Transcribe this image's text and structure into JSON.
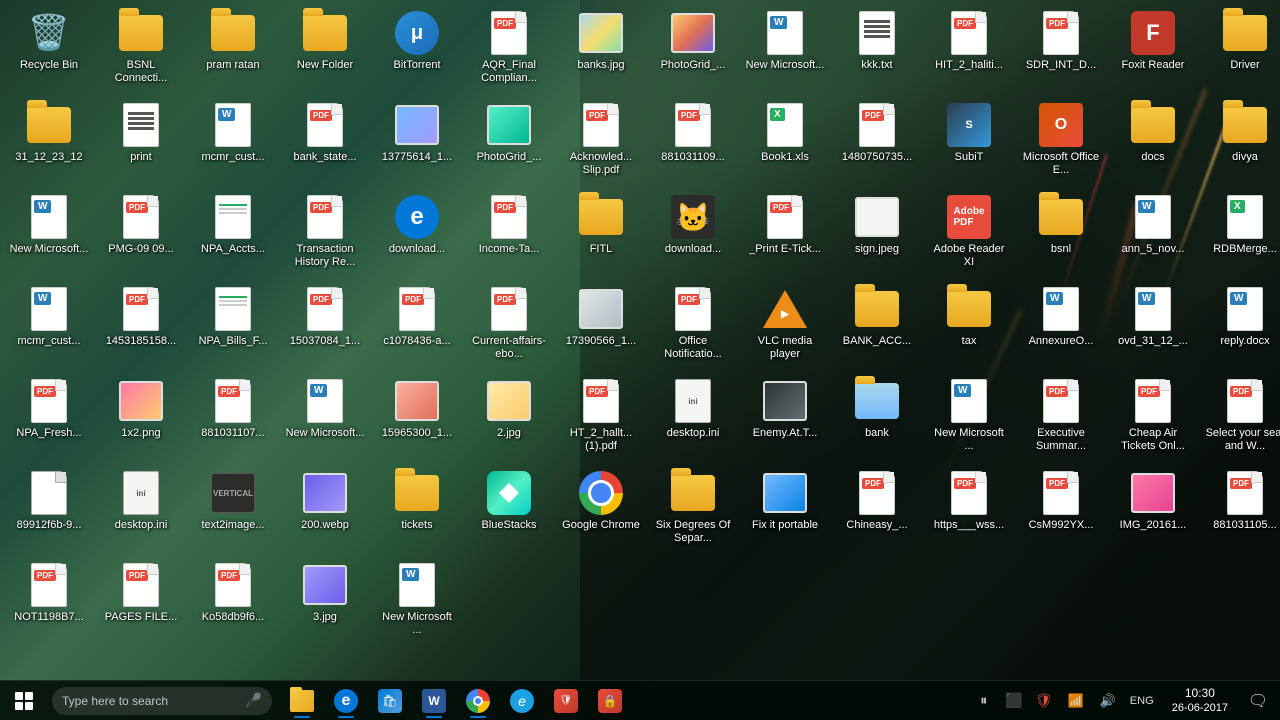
{
  "desktop": {
    "title": "Windows 10 Desktop",
    "background": "forest-highway-night"
  },
  "icons": {
    "row1": [
      {
        "id": "recycle-bin",
        "label": "Recycle Bin",
        "type": "recycle",
        "emoji": "🗑️"
      },
      {
        "id": "bsnl",
        "label": "BSNL Connecti...",
        "type": "folder"
      },
      {
        "id": "pram-ratan",
        "label": "pram ratan",
        "type": "folder"
      },
      {
        "id": "new-folder",
        "label": "New Folder",
        "type": "folder"
      },
      {
        "id": "bittorrent",
        "label": "BitTorrent",
        "type": "bittorrent"
      },
      {
        "id": "aqr-final",
        "label": "AQR_Final Complian...",
        "type": "pdf"
      },
      {
        "id": "banksjpg",
        "label": "banks.jpg",
        "type": "jpg"
      },
      {
        "id": "photogrid",
        "label": "PhotoGrid_...",
        "type": "jpg"
      },
      {
        "id": "new-ms1",
        "label": "New Microsoft...",
        "type": "word"
      },
      {
        "id": "kkktxt",
        "label": "kkk.txt",
        "type": "txt"
      },
      {
        "id": "hit2-halti",
        "label": "HIT_2_haliti...",
        "type": "pdf"
      },
      {
        "id": "sdr-int",
        "label": "SDR_INT_D...",
        "type": "pdf"
      }
    ],
    "row2": [
      {
        "id": "foxit",
        "label": "Foxit Reader",
        "type": "foxit"
      },
      {
        "id": "driver",
        "label": "Driver",
        "type": "folder"
      },
      {
        "id": "date-folder",
        "label": "31_12_23_12",
        "type": "folder"
      },
      {
        "id": "print",
        "label": "print",
        "type": "txt"
      },
      {
        "id": "mcmr-cust1",
        "label": "mcmr_cust...",
        "type": "word"
      },
      {
        "id": "bank-state",
        "label": "bank_state...",
        "type": "pdf"
      },
      {
        "id": "13775614",
        "label": "13775614_1...",
        "type": "jpg"
      },
      {
        "id": "photogrid2",
        "label": "PhotoGrid_...",
        "type": "jpg"
      },
      {
        "id": "acknowledge",
        "label": "Acknowled... Slip.pdf",
        "type": "pdf"
      },
      {
        "id": "8810311-09",
        "label": "881031109...",
        "type": "pdf"
      },
      {
        "id": "book1",
        "label": "Book1.xls",
        "type": "excel"
      },
      {
        "id": "1480750735",
        "label": "1480750735...",
        "type": "pdf"
      }
    ],
    "row3": [
      {
        "id": "subit",
        "label": "SubiT",
        "type": "subit"
      },
      {
        "id": "msoffice-e",
        "label": "Microsoft Office E...",
        "type": "msoffice"
      },
      {
        "id": "docs",
        "label": "docs",
        "type": "folder"
      },
      {
        "id": "divya",
        "label": "divya",
        "type": "folder"
      },
      {
        "id": "new-ms2",
        "label": "New Microsoft...",
        "type": "word"
      },
      {
        "id": "pmg-09",
        "label": "PMG-09 09...",
        "type": "pdf"
      },
      {
        "id": "npa-accts",
        "label": "NPA_Accts...",
        "type": "spreadsheet"
      },
      {
        "id": "transaction",
        "label": "Transaction History Re...",
        "type": "pdf"
      },
      {
        "id": "download1",
        "label": "download...",
        "type": "ie"
      },
      {
        "id": "income-tax",
        "label": "Income-Ta...",
        "type": "pdf"
      },
      {
        "id": "fitl",
        "label": "FITL",
        "type": "folder"
      },
      {
        "id": "download2",
        "label": "download...",
        "type": "jpg"
      },
      {
        "id": "print-e-tick",
        "label": "_Print E-Tick...",
        "type": "pdf"
      },
      {
        "id": "sign-jpeg",
        "label": "sign.jpeg",
        "type": "jpg"
      }
    ],
    "row4": [
      {
        "id": "adobe",
        "label": "Adobe Reader XI",
        "type": "adobe"
      },
      {
        "id": "bsnl2",
        "label": "bsnl",
        "type": "folder"
      },
      {
        "id": "ann5nov",
        "label": "ann_5_nov...",
        "type": "word"
      },
      {
        "id": "rdbmerge",
        "label": "RDBMerge...",
        "type": "excel"
      },
      {
        "id": "mcmr-cust2",
        "label": "mcmr_cust...",
        "type": "word"
      },
      {
        "id": "1453185158",
        "label": "1453185158...",
        "type": "pdf"
      },
      {
        "id": "npa-bills",
        "label": "NPA_Bills_F...",
        "type": "spreadsheet"
      },
      {
        "id": "15037084",
        "label": "15037084_1...",
        "type": "pdf"
      },
      {
        "id": "c1078436",
        "label": "c1078436-a...",
        "type": "pdf"
      },
      {
        "id": "current-affairs",
        "label": "Current-affairs-ebo...",
        "type": "pdf"
      },
      {
        "id": "17390566",
        "label": "17390566_1...",
        "type": "jpg"
      },
      {
        "id": "office-notif",
        "label": "Office Notificatio...",
        "type": "pdf"
      }
    ],
    "row5": [
      {
        "id": "vlc",
        "label": "VLC media player",
        "type": "vlc"
      },
      {
        "id": "bank-acc",
        "label": "BANK_ACC...",
        "type": "folder"
      },
      {
        "id": "tax",
        "label": "tax",
        "type": "folder"
      },
      {
        "id": "annexure",
        "label": "AnnexureO...",
        "type": "word"
      },
      {
        "id": "ovd31",
        "label": "ovd_31_12_...",
        "type": "word"
      },
      {
        "id": "reply-docx",
        "label": "reply.docx",
        "type": "word"
      },
      {
        "id": "npa-fresh",
        "label": "NPA_Fresh...",
        "type": "pdf"
      },
      {
        "id": "1x2png",
        "label": "1x2.png",
        "type": "png"
      },
      {
        "id": "881031107",
        "label": "881031107...",
        "type": "pdf"
      },
      {
        "id": "new-ms3",
        "label": "New Microsoft...",
        "type": "word"
      },
      {
        "id": "15965300",
        "label": "15965300_1...",
        "type": "pdf"
      },
      {
        "id": "2jpg",
        "label": "2.jpg",
        "type": "jpg"
      },
      {
        "id": "ht2-hallt",
        "label": "HT_2_hallt... (1).pdf",
        "type": "pdf"
      }
    ],
    "row6": [
      {
        "id": "desktop-ini1",
        "label": "desktop.ini",
        "type": "ini"
      },
      {
        "id": "enemy-at",
        "label": "Enemy.At.T...",
        "type": "jpg"
      },
      {
        "id": "bank",
        "label": "bank",
        "type": "folder"
      },
      {
        "id": "new-ms4",
        "label": "New Microsoft ...",
        "type": "word"
      },
      {
        "id": "executive",
        "label": "Executive Summar...",
        "type": "pdf"
      },
      {
        "id": "cheap-air",
        "label": "Cheap Air Tickets Onl...",
        "type": "pdf"
      },
      {
        "id": "select-seat",
        "label": "Select your seat and W...",
        "type": "pdf"
      },
      {
        "id": "89912f6b",
        "label": "89912f6b-9...",
        "type": "generic"
      },
      {
        "id": "desktop-ini2",
        "label": "desktop.ini",
        "type": "ini"
      },
      {
        "id": "text2image",
        "label": "text2image...",
        "type": "txt"
      },
      {
        "id": "200webp",
        "label": "200.webp",
        "type": "webp"
      },
      {
        "id": "tickets",
        "label": "tickets",
        "type": "folder"
      },
      {
        "id": "bluestacks",
        "label": "BlueStacks",
        "type": "bluestacks"
      }
    ],
    "row7": [
      {
        "id": "google-chrome",
        "label": "Google Chrome",
        "type": "chrome"
      },
      {
        "id": "six-degrees",
        "label": "Six Degrees Of Separ...",
        "type": "folder"
      },
      {
        "id": "fix-portable",
        "label": "Fix it portable",
        "type": "jpg"
      },
      {
        "id": "chineasy",
        "label": "Chineasy_...",
        "type": "pdf"
      },
      {
        "id": "https-wss",
        "label": "https___wss...",
        "type": "pdf"
      },
      {
        "id": "csm992yx",
        "label": "CsM992YX...",
        "type": "pdf"
      },
      {
        "id": "img-20161",
        "label": "IMG_20161...",
        "type": "jpg"
      },
      {
        "id": "881031105",
        "label": "881031105...",
        "type": "pdf"
      },
      {
        "id": "not1198b7",
        "label": "NOT1198B7...",
        "type": "pdf"
      },
      {
        "id": "pages-file",
        "label": "PAGES FILE...",
        "type": "pdf"
      },
      {
        "id": "ko58db9f6",
        "label": "Ko58db9f6...",
        "type": "pdf"
      },
      {
        "id": "3jpg",
        "label": "3.jpg",
        "type": "jpg"
      },
      {
        "id": "new-ms5",
        "label": "New Microsoft ...",
        "type": "word"
      }
    ]
  },
  "taskbar": {
    "search_placeholder": "Type here to search",
    "icons": [
      {
        "id": "file-explorer",
        "label": "File Explorer",
        "type": "folder-taskbar"
      },
      {
        "id": "edge",
        "label": "Microsoft Edge",
        "type": "edge"
      },
      {
        "id": "store",
        "label": "Microsoft Store",
        "type": "store"
      },
      {
        "id": "word-taskbar",
        "label": "Microsoft Word",
        "type": "word-taskbar"
      },
      {
        "id": "chrome-taskbar",
        "label": "Google Chrome",
        "type": "chrome-taskbar"
      },
      {
        "id": "ie-taskbar",
        "label": "Internet Explorer",
        "type": "ie-taskbar"
      },
      {
        "id": "unknown1",
        "label": "Unknown",
        "type": "generic-taskbar"
      },
      {
        "id": "antivirus",
        "label": "Antivirus",
        "type": "antivirus-taskbar"
      }
    ],
    "tray": {
      "time": "10:30",
      "date": "26-06-2017",
      "lang": "ENG"
    },
    "music_controls": [
      "⏸",
      "⬛"
    ]
  }
}
